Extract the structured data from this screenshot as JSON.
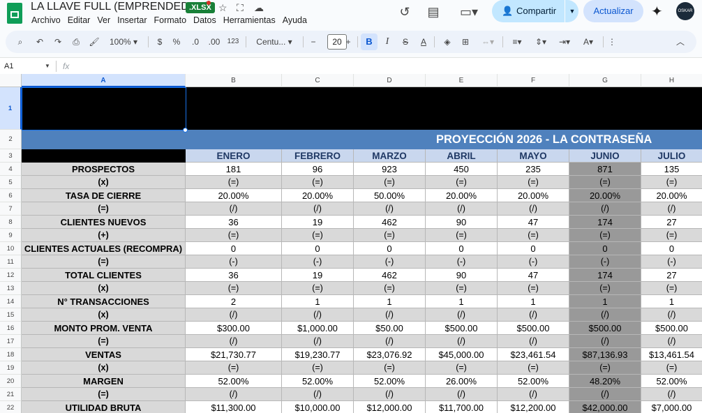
{
  "app": {
    "title": "LA LLAVE FULL (EMPRENDEDOR)",
    "file_badge": ".XLSX",
    "menu": [
      "Archivo",
      "Editar",
      "Ver",
      "Insertar",
      "Formato",
      "Datos",
      "Herramientas",
      "Ayuda"
    ],
    "share_label": "Compartir",
    "update_label": "Actualizar",
    "avatar_text": "OSKAR"
  },
  "toolbar": {
    "zoom": "100%",
    "currency": "$",
    "percent": "%",
    "dec_less": ".0",
    "dec_more": ".00",
    "number_format": "123",
    "font": "Centu...",
    "font_size": "20",
    "bold": "B",
    "italic": "I",
    "strike": "S",
    "text_color": "A"
  },
  "formula_bar": {
    "cell_ref": "A1",
    "fx": "fx",
    "value": ""
  },
  "sheet": {
    "columns": [
      "A",
      "B",
      "C",
      "D",
      "E",
      "F",
      "G",
      "H"
    ],
    "selected_column": "A",
    "header_title": "PROYECCIÓN 2026 - LA CONTRASEÑA",
    "months": [
      "ENERO",
      "FEBRERO",
      "MARZO",
      "ABRIL",
      "MAYO",
      "JUNIO",
      "JULIO"
    ],
    "rows": [
      {
        "n": "4",
        "label": "PROSPECTOS",
        "values": [
          "181",
          "96",
          "923",
          "450",
          "235",
          "871",
          "135"
        ]
      },
      {
        "n": "5",
        "label": "(x)",
        "values": [
          "(=)",
          "(=)",
          "(=)",
          "(=)",
          "(=)",
          "(=)",
          "(=)"
        ]
      },
      {
        "n": "6",
        "label": "TASA DE CIERRE",
        "values": [
          "20.00%",
          "20.00%",
          "50.00%",
          "20.00%",
          "20.00%",
          "20.00%",
          "20.00%"
        ]
      },
      {
        "n": "7",
        "label": "(=)",
        "values": [
          "(/)",
          "(/)",
          "(/)",
          "(/)",
          "(/)",
          "(/)",
          "(/)"
        ]
      },
      {
        "n": "8",
        "label": "CLIENTES NUEVOS",
        "values": [
          "36",
          "19",
          "462",
          "90",
          "47",
          "174",
          "27"
        ]
      },
      {
        "n": "9",
        "label": "(+)",
        "values": [
          "(=)",
          "(=)",
          "(=)",
          "(=)",
          "(=)",
          "(=)",
          "(=)"
        ]
      },
      {
        "n": "10",
        "label": "CLIENTES ACTUALES (RECOMPRA)",
        "values": [
          "0",
          "0",
          "0",
          "0",
          "0",
          "0",
          "0"
        ]
      },
      {
        "n": "11",
        "label": "(=)",
        "values": [
          "(-)",
          "(-)",
          "(-)",
          "(-)",
          "(-)",
          "(-)",
          "(-)"
        ]
      },
      {
        "n": "12",
        "label": "TOTAL CLIENTES",
        "values": [
          "36",
          "19",
          "462",
          "90",
          "47",
          "174",
          "27"
        ]
      },
      {
        "n": "13",
        "label": "(x)",
        "values": [
          "(=)",
          "(=)",
          "(=)",
          "(=)",
          "(=)",
          "(=)",
          "(=)"
        ]
      },
      {
        "n": "14",
        "label": "N° TRANSACCIONES",
        "values": [
          "2",
          "1",
          "1",
          "1",
          "1",
          "1",
          "1"
        ]
      },
      {
        "n": "15",
        "label": "(x)",
        "values": [
          "(/)",
          "(/)",
          "(/)",
          "(/)",
          "(/)",
          "(/)",
          "(/)"
        ]
      },
      {
        "n": "16",
        "label": "MONTO PROM. VENTA",
        "values": [
          "$300.00",
          "$1,000.00",
          "$50.00",
          "$500.00",
          "$500.00",
          "$500.00",
          "$500.00"
        ]
      },
      {
        "n": "17",
        "label": "(=)",
        "values": [
          "(/)",
          "(/)",
          "(/)",
          "(/)",
          "(/)",
          "(/)",
          "(/)"
        ]
      },
      {
        "n": "18",
        "label": "VENTAS",
        "values": [
          "$21,730.77",
          "$19,230.77",
          "$23,076.92",
          "$45,000.00",
          "$23,461.54",
          "$87,136.93",
          "$13,461.54"
        ]
      },
      {
        "n": "19",
        "label": "(x)",
        "values": [
          "(=)",
          "(=)",
          "(=)",
          "(=)",
          "(=)",
          "(=)",
          "(=)"
        ]
      },
      {
        "n": "20",
        "label": "MARGEN",
        "values": [
          "52.00%",
          "52.00%",
          "52.00%",
          "26.00%",
          "52.00%",
          "48.20%",
          "52.00%"
        ]
      },
      {
        "n": "21",
        "label": "(=)",
        "values": [
          "(/)",
          "(/)",
          "(/)",
          "(/)",
          "(/)",
          "(/)",
          "(/)"
        ]
      },
      {
        "n": "22",
        "label": "UTILIDAD BRUTA",
        "values": [
          "$11,300.00",
          "$10,000.00",
          "$12,000.00",
          "$11,700.00",
          "$12,200.00",
          "$42,000.00",
          "$7,000.00"
        ]
      }
    ],
    "row_numbers_top": [
      "1",
      "2",
      "3"
    ]
  },
  "colors": {
    "header_band": "#4f81bd",
    "month_text": "#1f3864",
    "label_bg": "#d9d9d9",
    "highlight_col": "#999999",
    "share_bg": "#c2e7ff",
    "update_bg": "#d3e3fd"
  }
}
